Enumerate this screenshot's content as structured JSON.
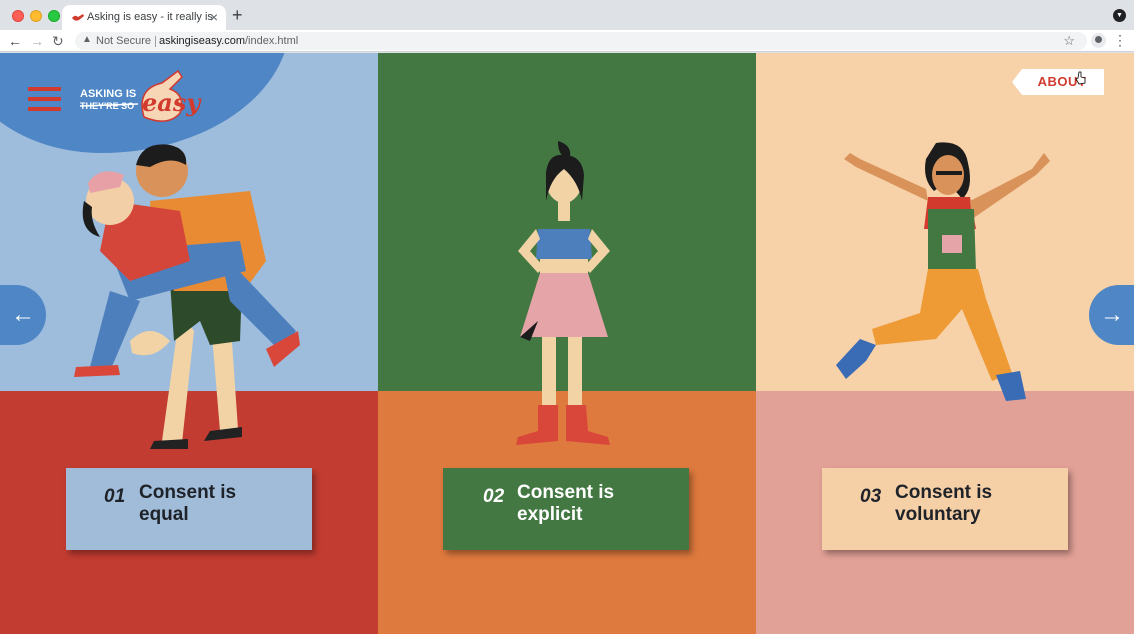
{
  "browser": {
    "tab_title": "Asking is easy - it really is",
    "tab_close": "×",
    "new_tab": "+",
    "security_label": "Not Secure",
    "url_domain": "askingiseasy.com",
    "url_path": "/index.html",
    "nav_back": "←",
    "nav_forward": "→",
    "nav_reload": "↻",
    "star": "☆",
    "menu": "⋮"
  },
  "site": {
    "logo_top": "ASKING IS",
    "logo_strike": "THEY'RE SO",
    "logo_script": "easy",
    "about_label": "ABOUT",
    "prev_arrow": "←",
    "next_arrow": "→"
  },
  "cards": [
    {
      "number": "01",
      "title": "Consent is equal"
    },
    {
      "number": "02",
      "title": "Consent is explicit"
    },
    {
      "number": "03",
      "title": "Consent is voluntary"
    }
  ],
  "colors": {
    "panel1_top": "#9ebcdc",
    "panel1_bottom": "#c33c31",
    "panel2_top": "#447843",
    "panel2_bottom": "#df7a3e",
    "panel3_top": "#f7d1a8",
    "panel3_bottom": "#e2a197",
    "accent_blue": "#4e86c6",
    "accent_red": "#d23a2e"
  }
}
